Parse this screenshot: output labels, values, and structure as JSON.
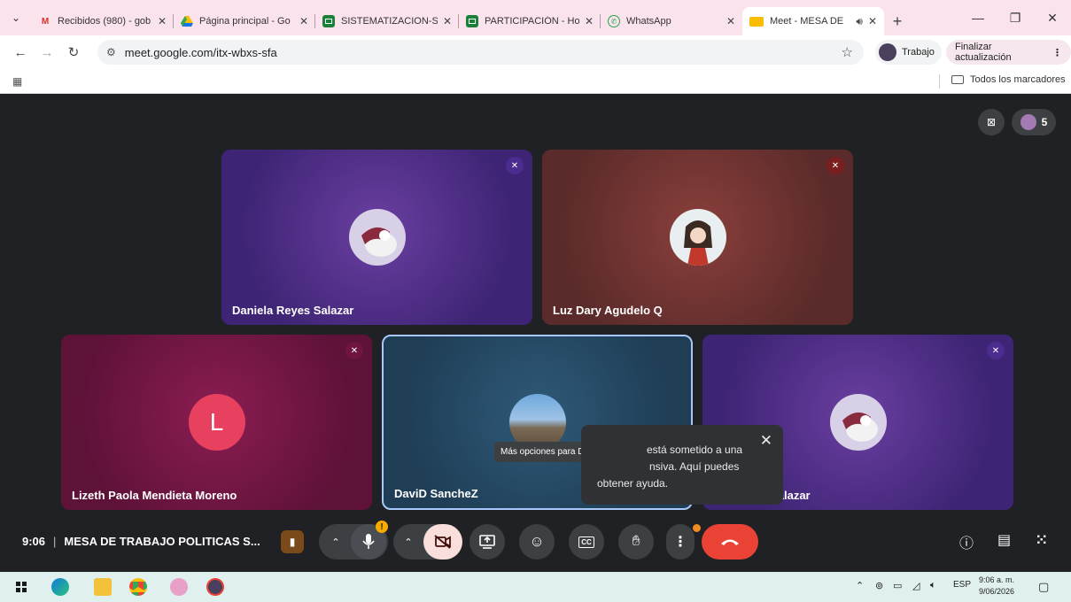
{
  "browser": {
    "tabs": [
      {
        "label": "Recibidos (980) - gob",
        "icon": "gmail-icon",
        "active": false
      },
      {
        "label": "Página principal - Go",
        "icon": "drive-icon",
        "active": false
      },
      {
        "label": "SISTEMATIZACION-S",
        "icon": "sheets-icon",
        "active": false
      },
      {
        "label": "PARTICIPACIÓN - Ho",
        "icon": "sheets-icon",
        "active": false
      },
      {
        "label": "WhatsApp",
        "icon": "whatsapp-icon",
        "active": false
      },
      {
        "label": "Meet - MESA DE",
        "icon": "meet-icon",
        "active": true
      }
    ],
    "url": "meet.google.com/itx-wbxs-sfa",
    "profile_label": "Trabajo",
    "update_label": "Finalizar actualización",
    "bookmarks_all": "Todos los marcadores"
  },
  "meet": {
    "participant_count": "5",
    "participants": [
      {
        "name": "Daniela Reyes Salazar",
        "avatar": "anime-avatar"
      },
      {
        "name": "Luz Dary Agudelo Q",
        "avatar": "anime-avatar"
      },
      {
        "name": "Lizeth Paola Mendieta Moreno",
        "avatar": "letter-avatar",
        "initial": "L"
      },
      {
        "name": "DaviD SancheZ",
        "avatar": "photo-avatar"
      },
      {
        "name": "es Salazar",
        "avatar": "anime-avatar"
      }
    ],
    "tooltip": "Más opciones para DaviD SancheZ",
    "snackbar": {
      "line1": "está sometido a una",
      "line2": "nsiva. Aquí puedes",
      "line3": "obtener ayuda."
    },
    "time": "9:06",
    "meeting_title": "MESA DE TRABAJO POLITICAS S...",
    "colors": {
      "end_call": "#ea4335",
      "camera_off": "#f9dedc",
      "tile_active_border": "#a8c7fa"
    }
  },
  "taskbar": {
    "lang": "ESP",
    "time": "9:06 a. m.",
    "date": "9/06/2026"
  }
}
